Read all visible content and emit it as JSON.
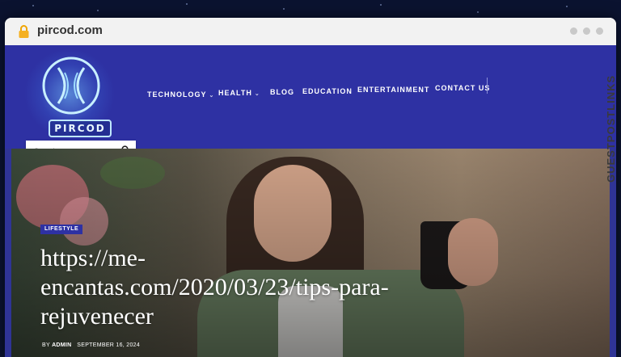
{
  "browser": {
    "url": "pircod.com"
  },
  "site": {
    "logo_text": "PIRCOD",
    "nav": [
      {
        "label": "TECHNOLOGY",
        "has_dropdown": true
      },
      {
        "label": "HEALTH",
        "has_dropdown": true
      },
      {
        "label": "BLOG",
        "has_dropdown": false
      },
      {
        "label": "EDUCATION",
        "has_dropdown": false
      },
      {
        "label": "ENTERTAINMENT",
        "has_dropdown": false
      },
      {
        "label": "CONTACT US",
        "has_dropdown": false
      }
    ],
    "search": {
      "placeholder": "Search..."
    }
  },
  "post": {
    "category": "LIFESTYLE",
    "title": "https://me-encantas.com/2020/03/23/tips-para-rejuvenecer",
    "by_label": "BY",
    "author": "ADMIN",
    "date": "SEPTEMBER 16, 2024"
  },
  "watermark": {
    "text": "GUESTPOSTLINKS"
  },
  "colors": {
    "header": "#2e31a3",
    "accent": "#2e31a3",
    "watermark": "#3a3a3a"
  }
}
